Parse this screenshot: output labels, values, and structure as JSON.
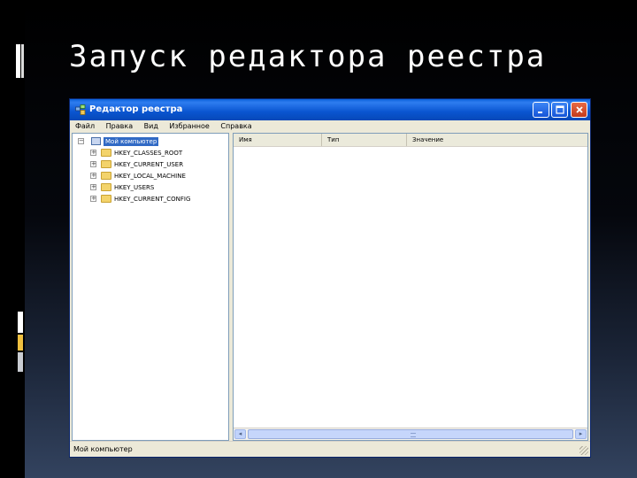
{
  "slide": {
    "title": "Запуск редактора реестра"
  },
  "window": {
    "title": "Редактор реестра",
    "controls": {
      "minimize_icon": "minimize-icon",
      "maximize_icon": "maximize-icon",
      "close_icon": "close-icon"
    }
  },
  "menu": {
    "items": [
      "Файл",
      "Правка",
      "Вид",
      "Избранное",
      "Справка"
    ]
  },
  "tree": {
    "root": "Мой компьютер",
    "keys": [
      "HKEY_CLASSES_ROOT",
      "HKEY_CURRENT_USER",
      "HKEY_LOCAL_MACHINE",
      "HKEY_USERS",
      "HKEY_CURRENT_CONFIG"
    ],
    "expander_collapsed": "+",
    "expander_expanded": "−"
  },
  "list": {
    "columns": [
      "Имя",
      "Тип",
      "Значение"
    ]
  },
  "scrollbar": {
    "left_arrow": "◂",
    "right_arrow": "▸"
  },
  "status": {
    "text": "Мой компьютер"
  },
  "colors": {
    "titlebar": "#0a55d0",
    "selection": "#316ac5",
    "folder": "#f3d36b",
    "window_bg": "#ece9d8",
    "accent_yellow": "#f0c040"
  }
}
